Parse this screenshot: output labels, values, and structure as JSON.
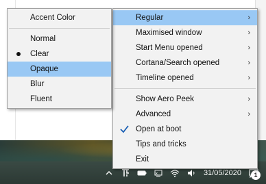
{
  "main_menu": {
    "items": [
      {
        "label": "Regular",
        "submenu": true,
        "highlighted": true
      },
      {
        "label": "Maximised window",
        "submenu": true
      },
      {
        "label": "Start Menu opened",
        "submenu": true
      },
      {
        "label": "Cortana/Search opened",
        "submenu": true
      },
      {
        "label": "Timeline opened",
        "submenu": true
      },
      {
        "separator": true
      },
      {
        "label": "Show Aero Peek",
        "submenu": true
      },
      {
        "label": "Advanced",
        "submenu": true
      },
      {
        "label": "Open at boot",
        "checked": true
      },
      {
        "label": "Tips and tricks"
      },
      {
        "label": "Exit"
      }
    ],
    "arrow": "›"
  },
  "sub_menu": {
    "header": "Accent Color",
    "items": [
      {
        "label": "Normal"
      },
      {
        "label": "Clear",
        "selected": true
      },
      {
        "label": "Opaque",
        "highlighted": true
      },
      {
        "label": "Blur"
      },
      {
        "label": "Fluent"
      }
    ]
  },
  "taskbar": {
    "date": "31/05/2020",
    "notification_count": "1",
    "icons": [
      "chevron-up-icon",
      "translucenttb-icon",
      "battery-icon",
      "network-icon",
      "wifi-icon",
      "volume-icon",
      "notification-icon"
    ]
  },
  "colors": {
    "highlight": "#99c8f4",
    "menu_bg": "#f2f2f2",
    "taskbar": "#2c3934"
  }
}
